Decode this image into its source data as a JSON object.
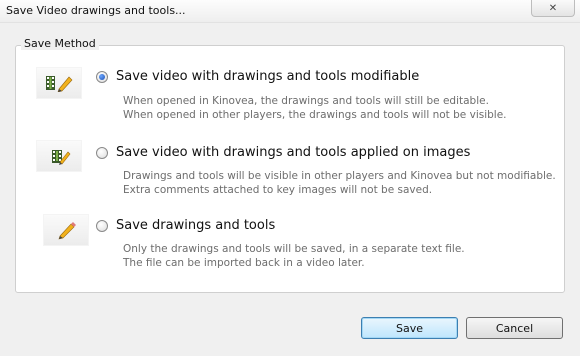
{
  "window": {
    "title": "Save Video drawings and tools...",
    "close_label": "✕"
  },
  "group": {
    "legend": "Save Method"
  },
  "options": [
    {
      "label": "Save video with drawings and tools modifiable",
      "desc1": "When opened in Kinovea, the drawings and tools will still be editable.",
      "desc2": "When opened in other players, the drawings and tools will not be visible.",
      "icon": "film-pencil-icon",
      "selected": true
    },
    {
      "label": "Save video with drawings and tools applied on images",
      "desc1": "Drawings and tools will be visible in other players and Kinovea but not modifiable.",
      "desc2": "Extra comments attached to key images will not be saved.",
      "icon": "film-brush-icon",
      "selected": false
    },
    {
      "label": "Save drawings and tools",
      "desc1": "Only the drawings and tools will be saved, in a separate text file.",
      "desc2": "The file can be imported back in a video later.",
      "icon": "pencil-icon",
      "selected": false
    }
  ],
  "buttons": {
    "save": "Save",
    "cancel": "Cancel"
  },
  "colors": {
    "accent": "#3c7fb1",
    "desc_text": "#6d6d6d"
  }
}
